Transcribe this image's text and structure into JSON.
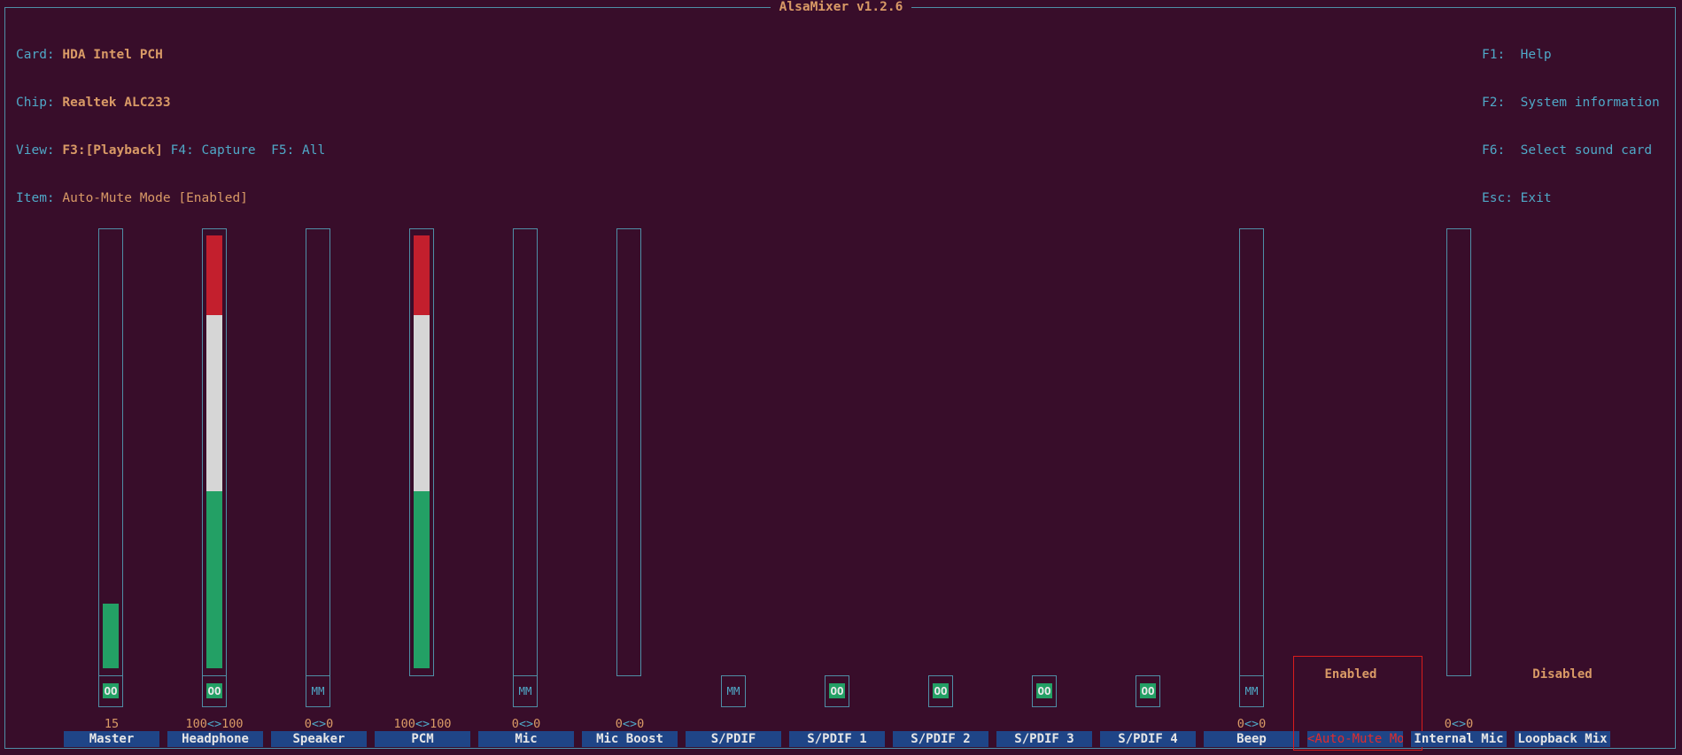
{
  "window": {
    "title": "AlsaMixer v1.2.6"
  },
  "info": {
    "card_label": "Card:",
    "card_value": "HDA Intel PCH",
    "chip_label": "Chip:",
    "chip_value": "Realtek ALC233",
    "view_label": "View:",
    "view_playback": "F3:[Playback]",
    "view_capture": "F4: Capture",
    "view_all": "F5: All",
    "item_label": "Item:",
    "item_value": "Auto-Mute Mode [Enabled]"
  },
  "keys": {
    "f1": "F1:  Help",
    "f2": "F2:  System information",
    "f6": "F6:  Select sound card",
    "esc": "Esc: Exit"
  },
  "controls": [
    {
      "name": "Master",
      "volume": "15",
      "switch": "OO",
      "level": 0.15
    },
    {
      "name": "Headphone",
      "volume_left": "100",
      "volume_sep": "<>",
      "volume_right": "100",
      "switch": "OO",
      "level": 1.0
    },
    {
      "name": "Speaker",
      "volume_left": "0",
      "volume_sep": "<>",
      "volume_right": "0",
      "switch": "MM",
      "level": 0
    },
    {
      "name": "PCM",
      "volume_left": "100",
      "volume_sep": "<>",
      "volume_right": "100",
      "level": 1.0
    },
    {
      "name": "Mic",
      "volume_left": "0",
      "volume_sep": "<>",
      "volume_right": "0",
      "switch": "MM",
      "level": 0
    },
    {
      "name": "Mic Boost",
      "volume_left": "0",
      "volume_sep": "<>",
      "volume_right": "0",
      "level": 0
    },
    {
      "name": "S/PDIF",
      "switch": "MM"
    },
    {
      "name": "S/PDIF 1",
      "switch": "OO"
    },
    {
      "name": "S/PDIF 2",
      "switch": "OO"
    },
    {
      "name": "S/PDIF 3",
      "switch": "OO"
    },
    {
      "name": "S/PDIF 4",
      "switch": "OO"
    },
    {
      "name": "Beep",
      "volume_left": "0",
      "volume_sep": "<>",
      "volume_right": "0",
      "switch": "MM",
      "level": 0
    },
    {
      "name": "<Auto-Mute Mo>",
      "enum_value": "Enabled",
      "selected": true
    },
    {
      "name": "Internal Mic",
      "volume_left": "0",
      "volume_sep": "<>",
      "volume_right": "0",
      "level": 0
    },
    {
      "name": "Loopback Mix",
      "enum_value": "Disabled"
    }
  ],
  "colors": {
    "background": "#380d2a",
    "border": "#4f8ea6",
    "accent": "#d99a66",
    "label": "#4fa8c7",
    "name_bg": "#1f4587",
    "selected": "#d91c1c",
    "meter_green": "#23a065",
    "meter_white": "#d6d6d6",
    "meter_red": "#c31f2d"
  }
}
